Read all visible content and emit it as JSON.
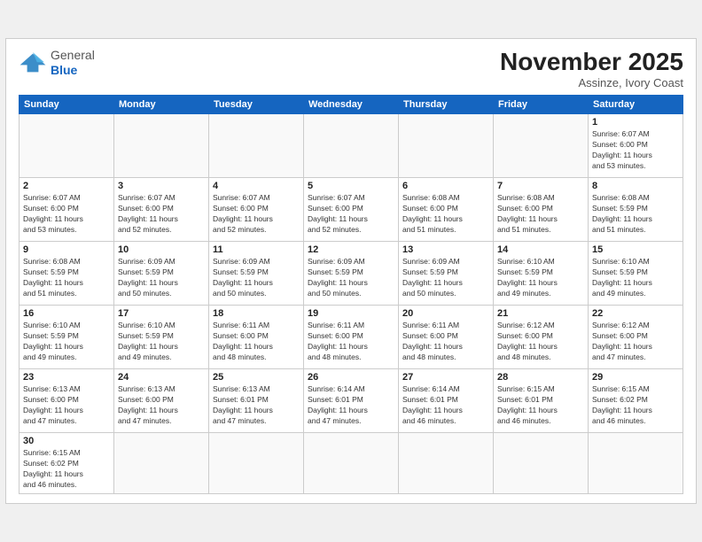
{
  "header": {
    "title": "November 2025",
    "location": "Assinze, Ivory Coast",
    "logo_general": "General",
    "logo_blue": "Blue"
  },
  "weekdays": [
    "Sunday",
    "Monday",
    "Tuesday",
    "Wednesday",
    "Thursday",
    "Friday",
    "Saturday"
  ],
  "days": [
    {
      "num": "",
      "info": ""
    },
    {
      "num": "",
      "info": ""
    },
    {
      "num": "",
      "info": ""
    },
    {
      "num": "",
      "info": ""
    },
    {
      "num": "",
      "info": ""
    },
    {
      "num": "",
      "info": ""
    },
    {
      "num": "1",
      "info": "Sunrise: 6:07 AM\nSunset: 6:00 PM\nDaylight: 11 hours\nand 53 minutes."
    },
    {
      "num": "2",
      "info": "Sunrise: 6:07 AM\nSunset: 6:00 PM\nDaylight: 11 hours\nand 53 minutes."
    },
    {
      "num": "3",
      "info": "Sunrise: 6:07 AM\nSunset: 6:00 PM\nDaylight: 11 hours\nand 52 minutes."
    },
    {
      "num": "4",
      "info": "Sunrise: 6:07 AM\nSunset: 6:00 PM\nDaylight: 11 hours\nand 52 minutes."
    },
    {
      "num": "5",
      "info": "Sunrise: 6:07 AM\nSunset: 6:00 PM\nDaylight: 11 hours\nand 52 minutes."
    },
    {
      "num": "6",
      "info": "Sunrise: 6:08 AM\nSunset: 6:00 PM\nDaylight: 11 hours\nand 51 minutes."
    },
    {
      "num": "7",
      "info": "Sunrise: 6:08 AM\nSunset: 6:00 PM\nDaylight: 11 hours\nand 51 minutes."
    },
    {
      "num": "8",
      "info": "Sunrise: 6:08 AM\nSunset: 5:59 PM\nDaylight: 11 hours\nand 51 minutes."
    },
    {
      "num": "9",
      "info": "Sunrise: 6:08 AM\nSunset: 5:59 PM\nDaylight: 11 hours\nand 51 minutes."
    },
    {
      "num": "10",
      "info": "Sunrise: 6:09 AM\nSunset: 5:59 PM\nDaylight: 11 hours\nand 50 minutes."
    },
    {
      "num": "11",
      "info": "Sunrise: 6:09 AM\nSunset: 5:59 PM\nDaylight: 11 hours\nand 50 minutes."
    },
    {
      "num": "12",
      "info": "Sunrise: 6:09 AM\nSunset: 5:59 PM\nDaylight: 11 hours\nand 50 minutes."
    },
    {
      "num": "13",
      "info": "Sunrise: 6:09 AM\nSunset: 5:59 PM\nDaylight: 11 hours\nand 50 minutes."
    },
    {
      "num": "14",
      "info": "Sunrise: 6:10 AM\nSunset: 5:59 PM\nDaylight: 11 hours\nand 49 minutes."
    },
    {
      "num": "15",
      "info": "Sunrise: 6:10 AM\nSunset: 5:59 PM\nDaylight: 11 hours\nand 49 minutes."
    },
    {
      "num": "16",
      "info": "Sunrise: 6:10 AM\nSunset: 5:59 PM\nDaylight: 11 hours\nand 49 minutes."
    },
    {
      "num": "17",
      "info": "Sunrise: 6:10 AM\nSunset: 5:59 PM\nDaylight: 11 hours\nand 49 minutes."
    },
    {
      "num": "18",
      "info": "Sunrise: 6:11 AM\nSunset: 6:00 PM\nDaylight: 11 hours\nand 48 minutes."
    },
    {
      "num": "19",
      "info": "Sunrise: 6:11 AM\nSunset: 6:00 PM\nDaylight: 11 hours\nand 48 minutes."
    },
    {
      "num": "20",
      "info": "Sunrise: 6:11 AM\nSunset: 6:00 PM\nDaylight: 11 hours\nand 48 minutes."
    },
    {
      "num": "21",
      "info": "Sunrise: 6:12 AM\nSunset: 6:00 PM\nDaylight: 11 hours\nand 48 minutes."
    },
    {
      "num": "22",
      "info": "Sunrise: 6:12 AM\nSunset: 6:00 PM\nDaylight: 11 hours\nand 47 minutes."
    },
    {
      "num": "23",
      "info": "Sunrise: 6:13 AM\nSunset: 6:00 PM\nDaylight: 11 hours\nand 47 minutes."
    },
    {
      "num": "24",
      "info": "Sunrise: 6:13 AM\nSunset: 6:00 PM\nDaylight: 11 hours\nand 47 minutes."
    },
    {
      "num": "25",
      "info": "Sunrise: 6:13 AM\nSunset: 6:01 PM\nDaylight: 11 hours\nand 47 minutes."
    },
    {
      "num": "26",
      "info": "Sunrise: 6:14 AM\nSunset: 6:01 PM\nDaylight: 11 hours\nand 47 minutes."
    },
    {
      "num": "27",
      "info": "Sunrise: 6:14 AM\nSunset: 6:01 PM\nDaylight: 11 hours\nand 46 minutes."
    },
    {
      "num": "28",
      "info": "Sunrise: 6:15 AM\nSunset: 6:01 PM\nDaylight: 11 hours\nand 46 minutes."
    },
    {
      "num": "29",
      "info": "Sunrise: 6:15 AM\nSunset: 6:02 PM\nDaylight: 11 hours\nand 46 minutes."
    },
    {
      "num": "30",
      "info": "Sunrise: 6:15 AM\nSunset: 6:02 PM\nDaylight: 11 hours\nand 46 minutes."
    },
    {
      "num": "",
      "info": ""
    },
    {
      "num": "",
      "info": ""
    },
    {
      "num": "",
      "info": ""
    },
    {
      "num": "",
      "info": ""
    },
    {
      "num": "",
      "info": ""
    },
    {
      "num": "",
      "info": ""
    }
  ]
}
